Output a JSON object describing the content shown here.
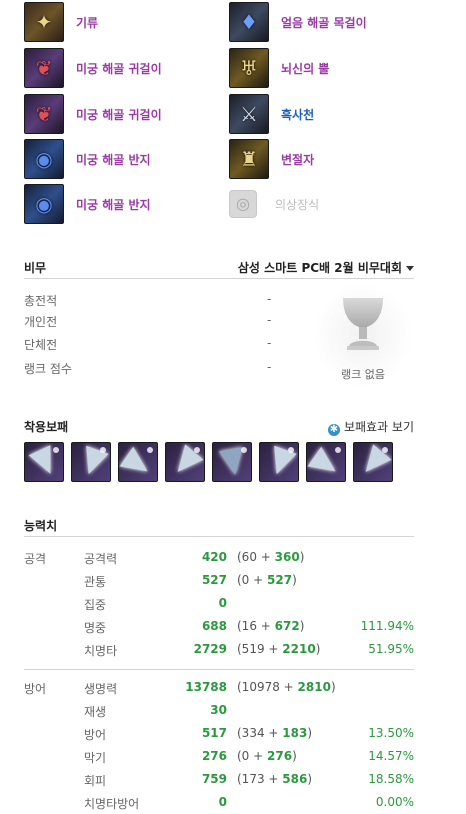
{
  "equipment": {
    "left": [
      {
        "label": "기류",
        "icon": "talisman-icon"
      },
      {
        "label": "미궁 해골 귀걸이",
        "icon": "earring-icon"
      },
      {
        "label": "미궁 해골 귀걸이",
        "icon": "earring-icon"
      },
      {
        "label": "미궁 해골 반지",
        "icon": "ring-icon"
      },
      {
        "label": "미궁 해골 반지",
        "icon": "ring-icon"
      }
    ],
    "right": [
      {
        "label": "얼음 해골 목걸이",
        "icon": "necklace-icon"
      },
      {
        "label": "뇌신의 뿔",
        "icon": "horns-icon"
      },
      {
        "label": "흑사천",
        "icon": "belt-icon"
      },
      {
        "label": "변절자",
        "icon": "costume-icon"
      },
      {
        "label": "의상장식",
        "icon": "costume-accessory-icon"
      }
    ]
  },
  "pvp": {
    "title": "비무",
    "event": "삼성 스마트 PC배 2월 비무대회",
    "rows": [
      {
        "label": "총전적",
        "value": "-"
      },
      {
        "label": "개인전",
        "value": "-"
      },
      {
        "label": "단체전",
        "value": "-"
      },
      {
        "label": "랭크 점수",
        "value": "-"
      }
    ],
    "rank_label": "랭크 없음"
  },
  "soul_shield": {
    "title": "착용보패",
    "link": "보패효과 보기",
    "count": 8
  },
  "stats": {
    "title": "능력치",
    "attack": {
      "group": "공격",
      "rows": [
        {
          "name": "공격력",
          "total": "420",
          "base": "(60 + ",
          "bonus": "360",
          "close": ")",
          "pct": ""
        },
        {
          "name": "관통",
          "total": "527",
          "base": "(0 + ",
          "bonus": "527",
          "close": ")",
          "pct": ""
        },
        {
          "name": "집중",
          "total": "0",
          "base": "",
          "bonus": "",
          "close": "",
          "pct": ""
        },
        {
          "name": "명중",
          "total": "688",
          "base": "(16 + ",
          "bonus": "672",
          "close": ")",
          "pct": "111.94%"
        },
        {
          "name": "치명타",
          "total": "2729",
          "base": "(519 + ",
          "bonus": "2210",
          "close": ")",
          "pct": "51.95%"
        }
      ]
    },
    "defense": {
      "group": "방어",
      "rows": [
        {
          "name": "생명력",
          "total": "13788",
          "base": "(10978 + ",
          "bonus": "2810",
          "close": ")",
          "pct": ""
        },
        {
          "name": "재생",
          "total": "30",
          "base": "",
          "bonus": "",
          "close": "",
          "pct": ""
        },
        {
          "name": "방어",
          "total": "517",
          "base": "(334 + ",
          "bonus": "183",
          "close": ")",
          "pct": "13.50%"
        },
        {
          "name": "막기",
          "total": "276",
          "base": "(0 + ",
          "bonus": "276",
          "close": ")",
          "pct": "14.57%"
        },
        {
          "name": "회피",
          "total": "759",
          "base": "(173 + ",
          "bonus": "586",
          "close": ")",
          "pct": "18.58%"
        },
        {
          "name": "치명타방어",
          "total": "0",
          "base": "",
          "bonus": "",
          "close": "",
          "pct": "0.00%"
        }
      ]
    }
  }
}
